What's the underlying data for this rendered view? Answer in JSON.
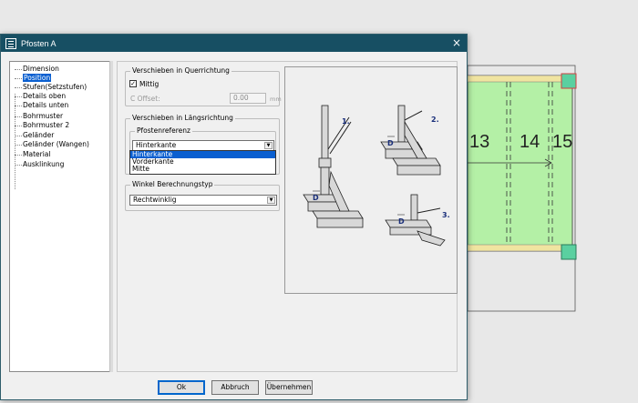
{
  "background": {
    "labels": [
      "13",
      "14",
      "15"
    ]
  },
  "dialog": {
    "title": "Pfosten A",
    "close_glyph": "×"
  },
  "tree": {
    "items": [
      {
        "label": "Dimension",
        "selected": false
      },
      {
        "label": "Position",
        "selected": true
      },
      {
        "label": "Stufen(Setzstufen)",
        "selected": false
      },
      {
        "label": "Details oben",
        "selected": false
      },
      {
        "label": "Details unten",
        "selected": false
      },
      {
        "label": "Bohrmuster",
        "selected": false
      },
      {
        "label": "Bohrmuster 2",
        "selected": false
      },
      {
        "label": "Geländer",
        "selected": false
      },
      {
        "label": "Geländer (Wangen)",
        "selected": false
      },
      {
        "label": "Material",
        "selected": false
      },
      {
        "label": "Ausklinkung",
        "selected": false
      }
    ]
  },
  "quer": {
    "title": "Verschieben in Querrichtung",
    "mittig_label": "Mittig",
    "mittig_checked": true,
    "offset_label": "C Offset:",
    "offset_value": "0.00",
    "offset_unit": "mm"
  },
  "laengs": {
    "title": "Verschieben in Längsrichtung",
    "ref_title": "Pfostenreferenz",
    "ref_selected": "Hinterkante",
    "options": [
      "Hinterkante",
      "Vorderkante",
      "Mitte"
    ],
    "highlighted_option": "Hinterkante"
  },
  "winkel": {
    "title": "Winkel Berechnungstyp",
    "selected": "Rechtwinklig"
  },
  "illustration": {
    "labels": [
      "1.",
      "2.",
      "3."
    ],
    "d_label": "D"
  },
  "buttons": {
    "ok": "Ok",
    "cancel": "Abbruch",
    "apply": "Übernehmen"
  }
}
